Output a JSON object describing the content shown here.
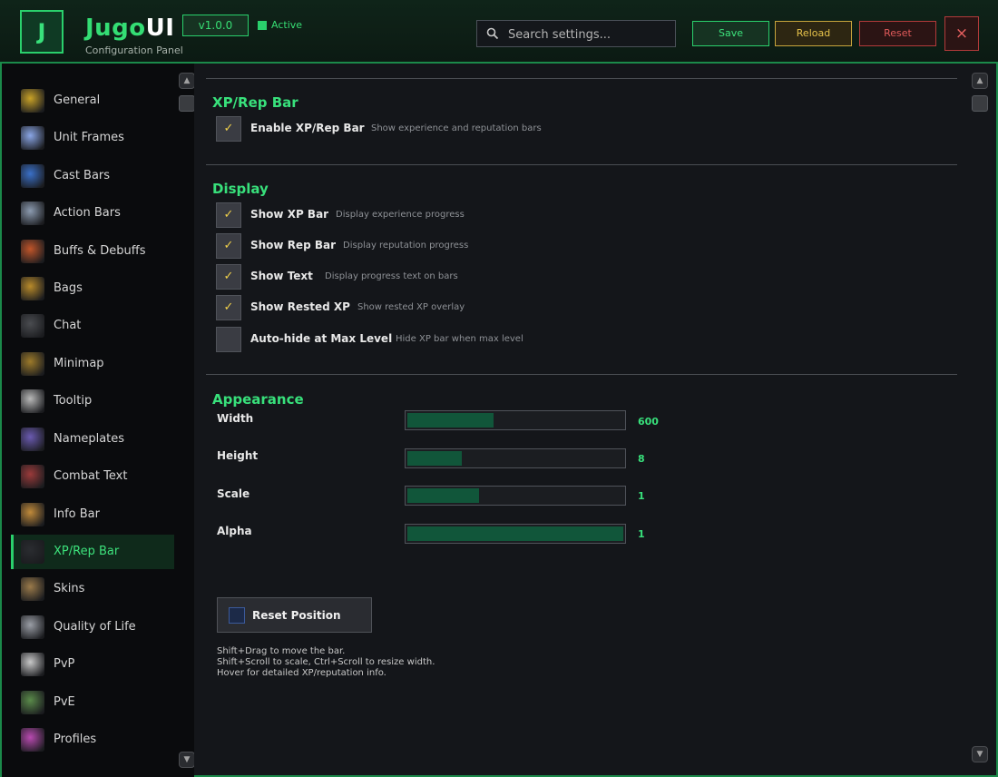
{
  "header": {
    "logo_letter": "J",
    "app_name": "Jugo",
    "app_name_suffix": "UI",
    "subtitle": "Configuration Panel",
    "version": "v1.0.0",
    "status": "Active",
    "search_placeholder": "Search settings...",
    "save_label": "Save",
    "reload_label": "Reload",
    "reset_label": "Reset",
    "close_label": "×"
  },
  "sidebar": {
    "items": [
      {
        "label": "General",
        "icon": "gear-icon",
        "color": "#c9a227"
      },
      {
        "label": "Unit Frames",
        "icon": "sparkle-icon",
        "color": "#8aa6e6"
      },
      {
        "label": "Cast Bars",
        "icon": "cast-icon",
        "color": "#3a70c8"
      },
      {
        "label": "Action Bars",
        "icon": "hand-icon",
        "color": "#8c9bb0"
      },
      {
        "label": "Buffs & Debuffs",
        "icon": "buff-icon",
        "color": "#c0552a"
      },
      {
        "label": "Bags",
        "icon": "bag-icon",
        "color": "#b88a2a"
      },
      {
        "label": "Chat",
        "icon": "chat-icon",
        "color": "#4a4c50"
      },
      {
        "label": "Minimap",
        "icon": "map-icon",
        "color": "#9c7a2a"
      },
      {
        "label": "Tooltip",
        "icon": "scroll-icon",
        "color": "#b8b8b8"
      },
      {
        "label": "Nameplates",
        "icon": "nameplate-icon",
        "color": "#6a5ab0"
      },
      {
        "label": "Combat Text",
        "icon": "combat-text-icon",
        "color": "#9a3a3a"
      },
      {
        "label": "Info Bar",
        "icon": "info-icon",
        "color": "#c08a3a"
      },
      {
        "label": "XP/Rep Bar",
        "icon": "xp-icon",
        "color": "#2a2c30",
        "active": true
      },
      {
        "label": "Skins",
        "icon": "skin-icon",
        "color": "#9a7a4a"
      },
      {
        "label": "Quality of Life",
        "icon": "helmet-icon",
        "color": "#9a9ea6"
      },
      {
        "label": "PvP",
        "icon": "swords-icon",
        "color": "#c8c8c8"
      },
      {
        "label": "PvE",
        "icon": "pve-icon",
        "color": "#5a8a4a"
      },
      {
        "label": "Profiles",
        "icon": "profile-icon",
        "color": "#b84ab0"
      }
    ]
  },
  "main": {
    "xp_section": {
      "title": "XP/Rep Bar",
      "enable": {
        "label": "Enable XP/Rep Bar",
        "desc": "Show experience and reputation bars",
        "checked": true
      }
    },
    "display_section": {
      "title": "Display",
      "options": [
        {
          "label": "Show XP Bar",
          "desc": "Display experience progress",
          "checked": true
        },
        {
          "label": "Show Rep Bar",
          "desc": "Display reputation progress",
          "checked": true
        },
        {
          "label": "Show Text",
          "desc": "Display progress text on bars",
          "checked": true
        },
        {
          "label": "Show Rested XP",
          "desc": "Show rested XP overlay",
          "checked": true
        },
        {
          "label": "Auto-hide at Max Level",
          "desc": "Hide XP bar when max level",
          "checked": false
        }
      ]
    },
    "appearance_section": {
      "title": "Appearance",
      "sliders": [
        {
          "label": "Width",
          "value": "600",
          "fill": 0.4
        },
        {
          "label": "Height",
          "value": "8",
          "fill": 0.25
        },
        {
          "label": "Scale",
          "value": "1",
          "fill": 0.33
        },
        {
          "label": "Alpha",
          "value": "1",
          "fill": 1.0
        }
      ]
    },
    "reset_position_label": "Reset Position",
    "help_lines": [
      "Shift+Drag to move the bar.",
      "Shift+Scroll to scale, Ctrl+Scroll to resize width.",
      "Hover for detailed XP/reputation info."
    ],
    "checkmark": "✓"
  },
  "colors": {
    "accent": "#2ad06c",
    "save": "#3de27c",
    "reload": "#e6c24a",
    "reset": "#e05a5a"
  }
}
